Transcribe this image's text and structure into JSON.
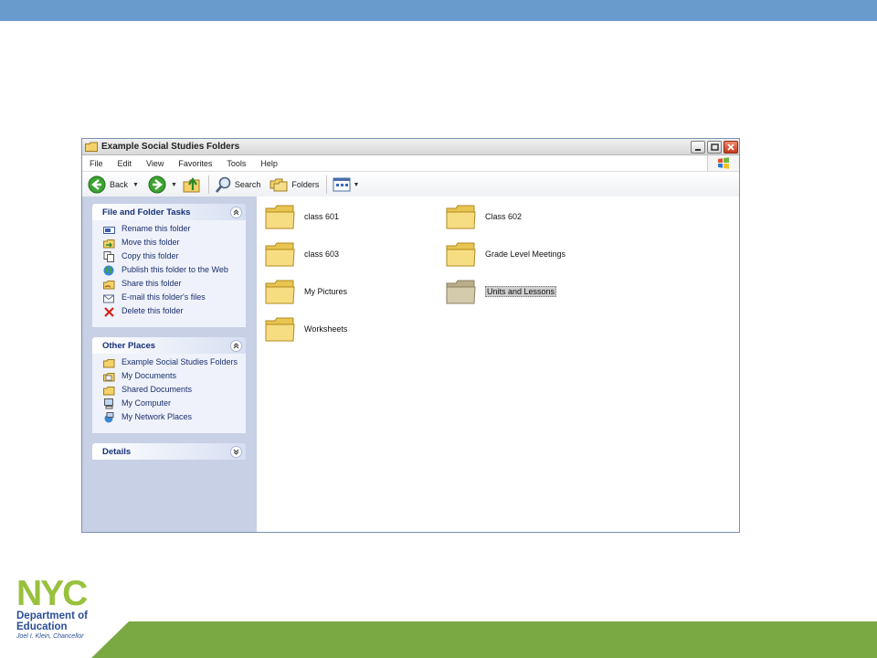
{
  "window": {
    "title": "Example Social Studies Folders",
    "menu": [
      "File",
      "Edit",
      "View",
      "Favorites",
      "Tools",
      "Help"
    ],
    "toolbar": {
      "back": "Back",
      "search": "Search",
      "folders": "Folders"
    }
  },
  "sidebar": {
    "file_tasks": {
      "title": "File and Folder Tasks",
      "items": [
        {
          "label": "Rename this folder",
          "icon": "rename-icon"
        },
        {
          "label": "Move this folder",
          "icon": "move-icon"
        },
        {
          "label": "Copy this folder",
          "icon": "copy-icon"
        },
        {
          "label": "Publish this folder to the Web",
          "icon": "globe-icon"
        },
        {
          "label": "Share this folder",
          "icon": "share-icon"
        },
        {
          "label": "E-mail this folder's files",
          "icon": "email-icon"
        },
        {
          "label": "Delete this folder",
          "icon": "delete-icon"
        }
      ]
    },
    "other_places": {
      "title": "Other Places",
      "items": [
        {
          "label": "Example Social Studies Folders",
          "icon": "folder-icon"
        },
        {
          "label": "My Documents",
          "icon": "my-documents-icon"
        },
        {
          "label": "Shared Documents",
          "icon": "folder-icon"
        },
        {
          "label": "My Computer",
          "icon": "computer-icon"
        },
        {
          "label": "My Network Places",
          "icon": "network-icon"
        }
      ]
    },
    "details": {
      "title": "Details"
    }
  },
  "folders": [
    {
      "name": "class 601",
      "selected": false
    },
    {
      "name": "Class 602",
      "selected": false
    },
    {
      "name": "class 603",
      "selected": false
    },
    {
      "name": "Grade Level Meetings",
      "selected": false
    },
    {
      "name": "My Pictures",
      "selected": false
    },
    {
      "name": "Units and Lessons",
      "selected": true
    },
    {
      "name": "Worksheets",
      "selected": false
    }
  ],
  "logo": {
    "mark": "NYC",
    "line1": "Department of",
    "line2": "Education",
    "line3": "Joel I. Klein, Chancellor"
  },
  "colors": {
    "top_band": "#6a9bcd",
    "bottom_band": "#7aa944",
    "folder_yellow": "#f6d774",
    "logo_blue": "#2a4f97",
    "logo_green": "#98c13d"
  }
}
